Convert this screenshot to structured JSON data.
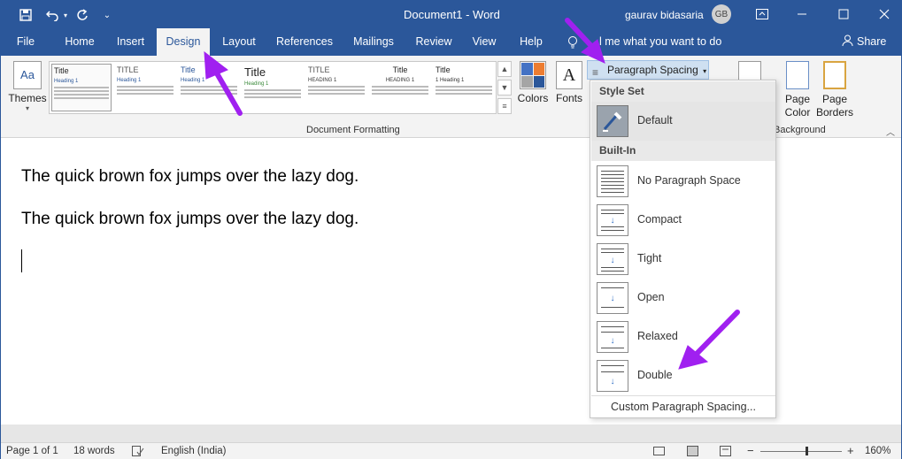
{
  "titlebar": {
    "doc_title": "Document1 - Word",
    "user_name": "gaurav bidasaria",
    "avatar_initials": "GB",
    "save_icon": "save-icon",
    "undo_icon": "undo-icon",
    "redo_icon": "redo-icon",
    "customize_icon": "chevron-down-icon"
  },
  "tabs": [
    "File",
    "Home",
    "Insert",
    "Design",
    "Layout",
    "References",
    "Mailings",
    "Review",
    "View",
    "Help"
  ],
  "active_tab": "Design",
  "tell_me": "l me what you want to do",
  "share": "Share",
  "ribbon": {
    "themes_label": "Themes",
    "style_thumbs": [
      {
        "title": "Title",
        "heading": "Heading 1"
      },
      {
        "title": "TITLE",
        "heading": "Heading 1"
      },
      {
        "title": "Title",
        "heading": "Heading 1"
      },
      {
        "title": "Title",
        "heading": "Heading 1"
      },
      {
        "title": "TITLE",
        "heading": "HEADING 1"
      },
      {
        "title": "Title",
        "heading": "HEADING 1"
      },
      {
        "title": "Title",
        "heading": "1 Heading 1"
      }
    ],
    "colors_label": "Colors",
    "fonts_label": "Fonts",
    "fonts_glyph": "A",
    "paragraph_spacing_label": "Paragraph Spacing",
    "page_color_label": "Page Color",
    "page_borders_label": "Page Borders",
    "group_document_formatting": "Document Formatting",
    "group_background": "Background"
  },
  "document": {
    "lines": [
      "The quick brown fox jumps over the lazy dog.",
      "The quick brown fox jumps over the lazy dog."
    ]
  },
  "status": {
    "page": "Page 1 of 1",
    "words": "18 words",
    "language": "English (India)",
    "zoom": "160%"
  },
  "dropdown": {
    "style_set_header": "Style Set",
    "default_label": "Default",
    "builtin_header": "Built-In",
    "items": [
      "No Paragraph Space",
      "Compact",
      "Tight",
      "Open",
      "Relaxed",
      "Double"
    ],
    "custom_label": "Custom Paragraph Spacing..."
  },
  "colors": {
    "accent": "#2b579a",
    "annotation_arrow": "#a020f0"
  }
}
